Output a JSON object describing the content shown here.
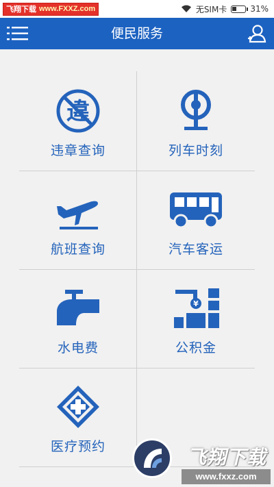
{
  "status_bar": {
    "watermark_label": "飞翔下载",
    "watermark_url": "www.FXXZ.com",
    "carrier": "无SIM卡",
    "battery": "31%",
    "battery_fraction": 0.31,
    "icons": [
      "wifi-icon",
      "battery-icon"
    ]
  },
  "header": {
    "title": "便民服务",
    "icons": [
      "menu-icon",
      "user-icon"
    ],
    "background_color": "#1c62c1"
  },
  "services": [
    {
      "label": "违章查询",
      "icon": "violation-icon"
    },
    {
      "label": "列车时刻",
      "icon": "train-icon"
    },
    {
      "label": "航班查询",
      "icon": "airplane-icon"
    },
    {
      "label": "汽车客运",
      "icon": "bus-icon"
    },
    {
      "label": "水电费",
      "icon": "faucet-icon"
    },
    {
      "label": "公积金",
      "icon": "fund-icon"
    },
    {
      "label": "医疗预约",
      "icon": "medical-icon"
    }
  ],
  "accent_color": "#2463bb",
  "watermark": {
    "name": "飞翔下载",
    "url": "www.fxxz.com"
  }
}
